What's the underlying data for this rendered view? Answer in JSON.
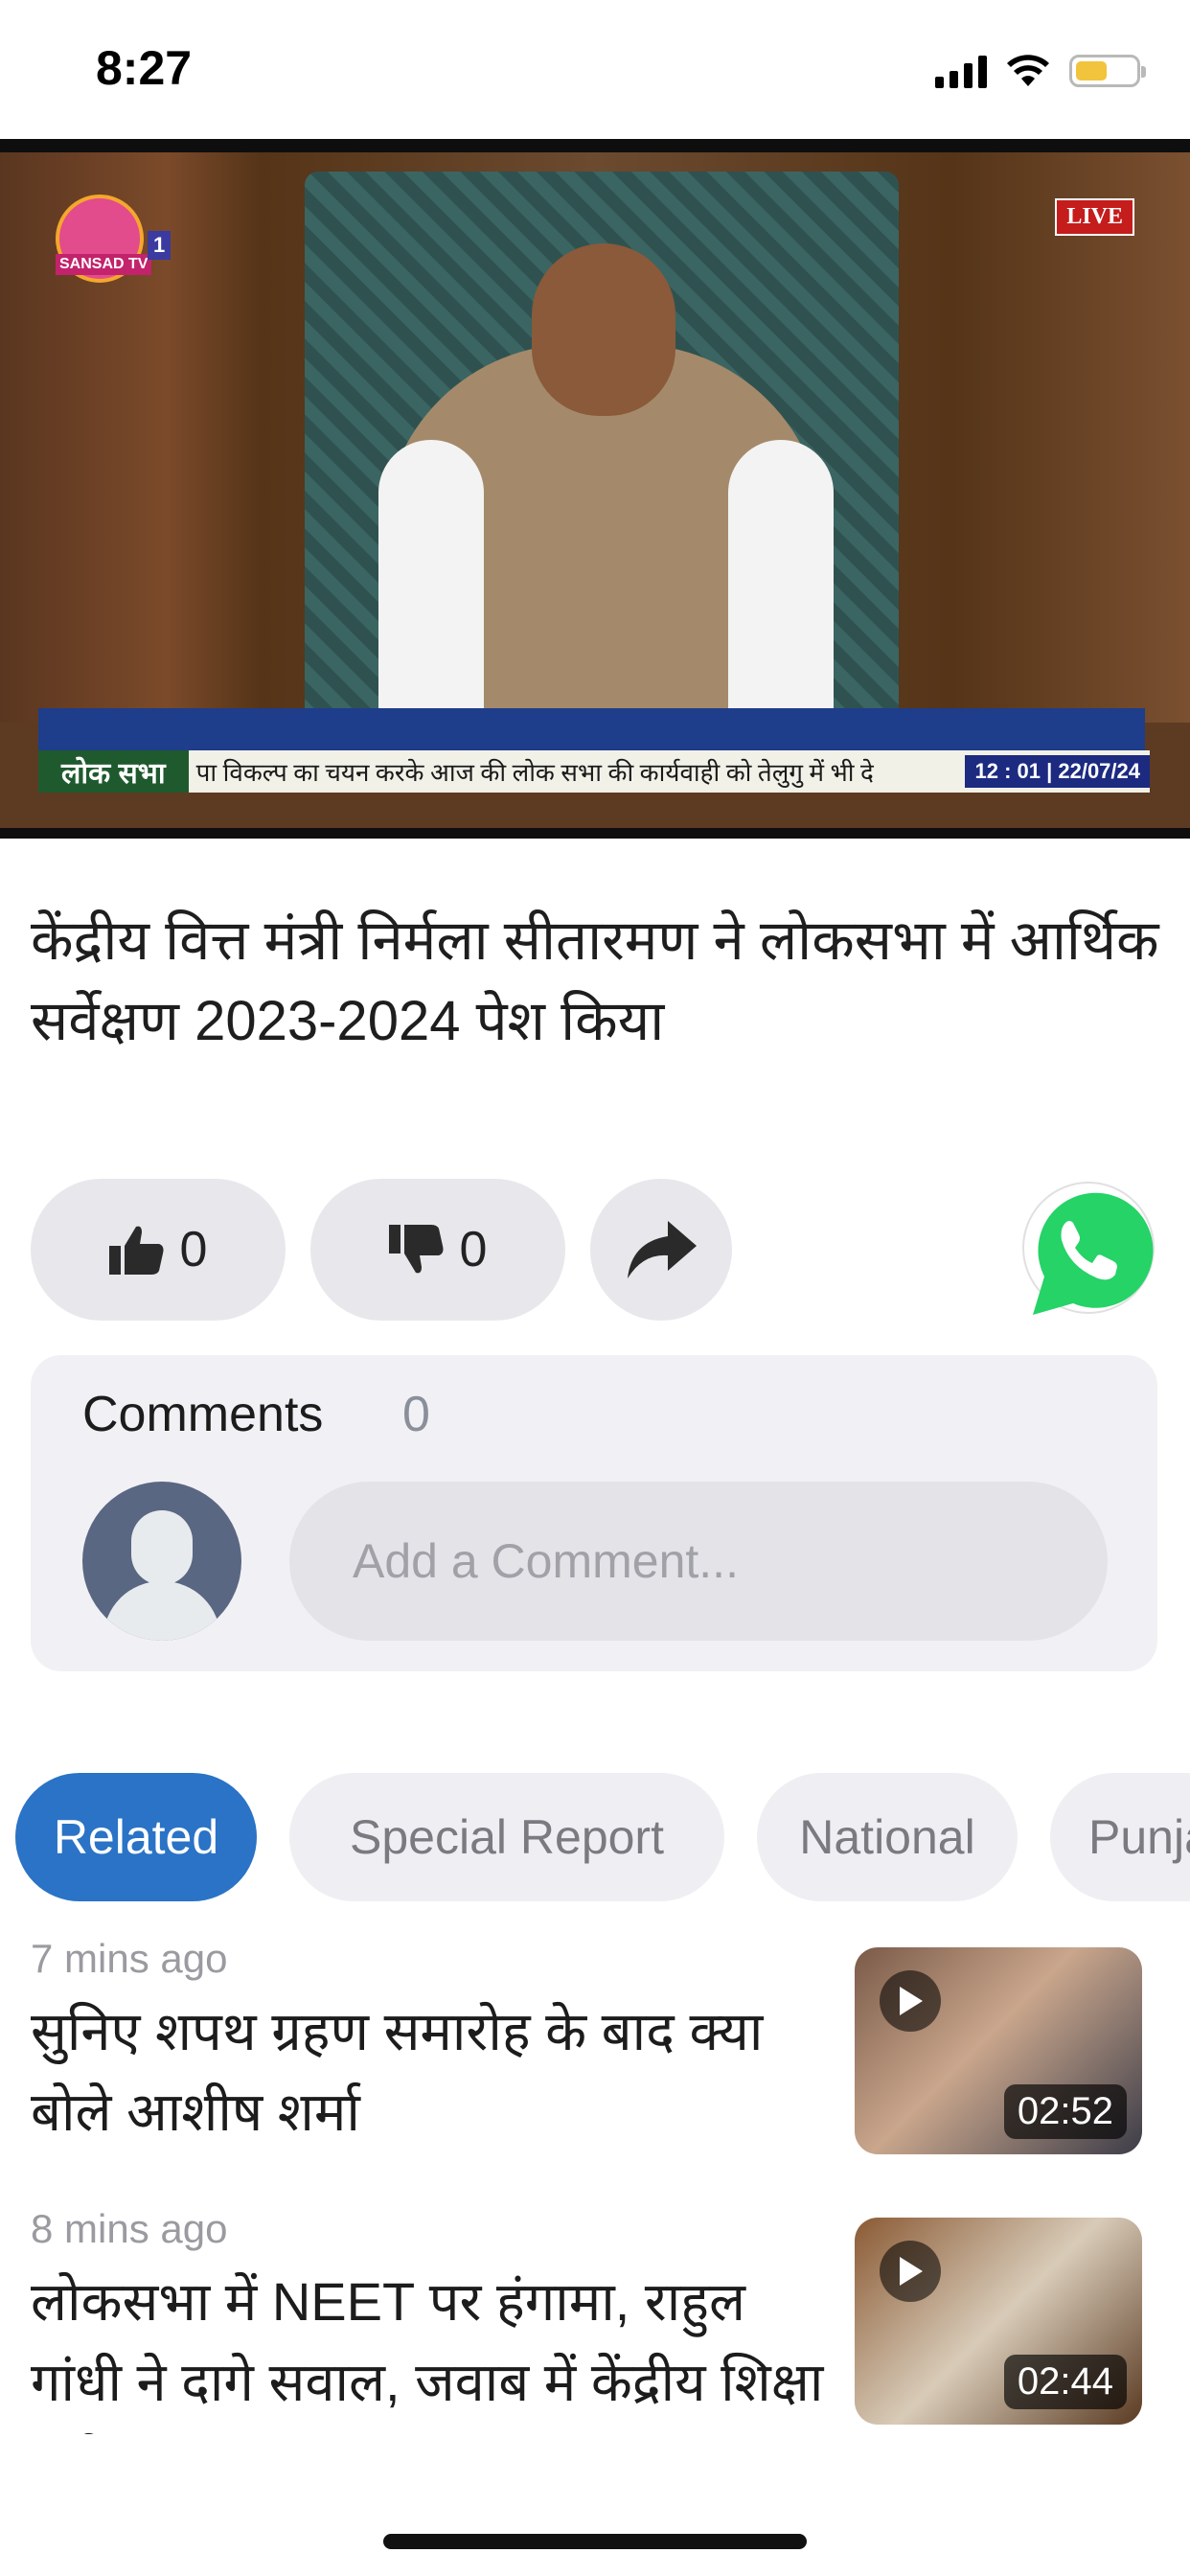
{
  "status_bar": {
    "time": "8:27"
  },
  "video": {
    "channel_logo": "SANSAD TV",
    "channel_num": "1",
    "live_label": "LIVE",
    "ticker_house": "लोक सभा",
    "ticker_text": "पा विकल्प का चयन करके आज की लोक सभा की कार्यवाही को तेलुगु में भी दे",
    "ticker_time": "12 : 01 | 22/07/24"
  },
  "article": {
    "title": "केंद्रीय वित्त मंत्री निर्मला सीतारमण ने लोकसभा में आर्थिक सर्वेक्षण 2023-2024 पेश किया"
  },
  "reactions": {
    "likes": "0",
    "dislikes": "0"
  },
  "comments": {
    "label": "Comments",
    "count": "0",
    "placeholder": "Add a Comment..."
  },
  "tabs": [
    {
      "label": "Related",
      "active": true
    },
    {
      "label": "Special Report",
      "active": false
    },
    {
      "label": "National",
      "active": false
    },
    {
      "label": "Punjab",
      "active": false
    }
  ],
  "news": [
    {
      "ago": "7 mins ago",
      "headline": "सुनिए शपथ ग्रहण समारोह के बाद क्या बोले आशीष शर्मा",
      "duration": "02:52"
    },
    {
      "ago": "8 mins ago",
      "headline": "लोकसभा में NEET पर हंगामा, राहुल गांधी ने दागे सवाल, जवाब में केंद्रीय शिक्षा मंत्री ...",
      "duration": "02:44"
    }
  ],
  "colors": {
    "accent": "#2a73c6",
    "whatsapp": "#25d366",
    "live": "#c51c1c"
  },
  "icons": {
    "like": "thumbs-up-icon",
    "dislike": "thumbs-down-icon",
    "share": "share-arrow-icon",
    "whatsapp": "whatsapp-icon",
    "play": "play-icon"
  }
}
